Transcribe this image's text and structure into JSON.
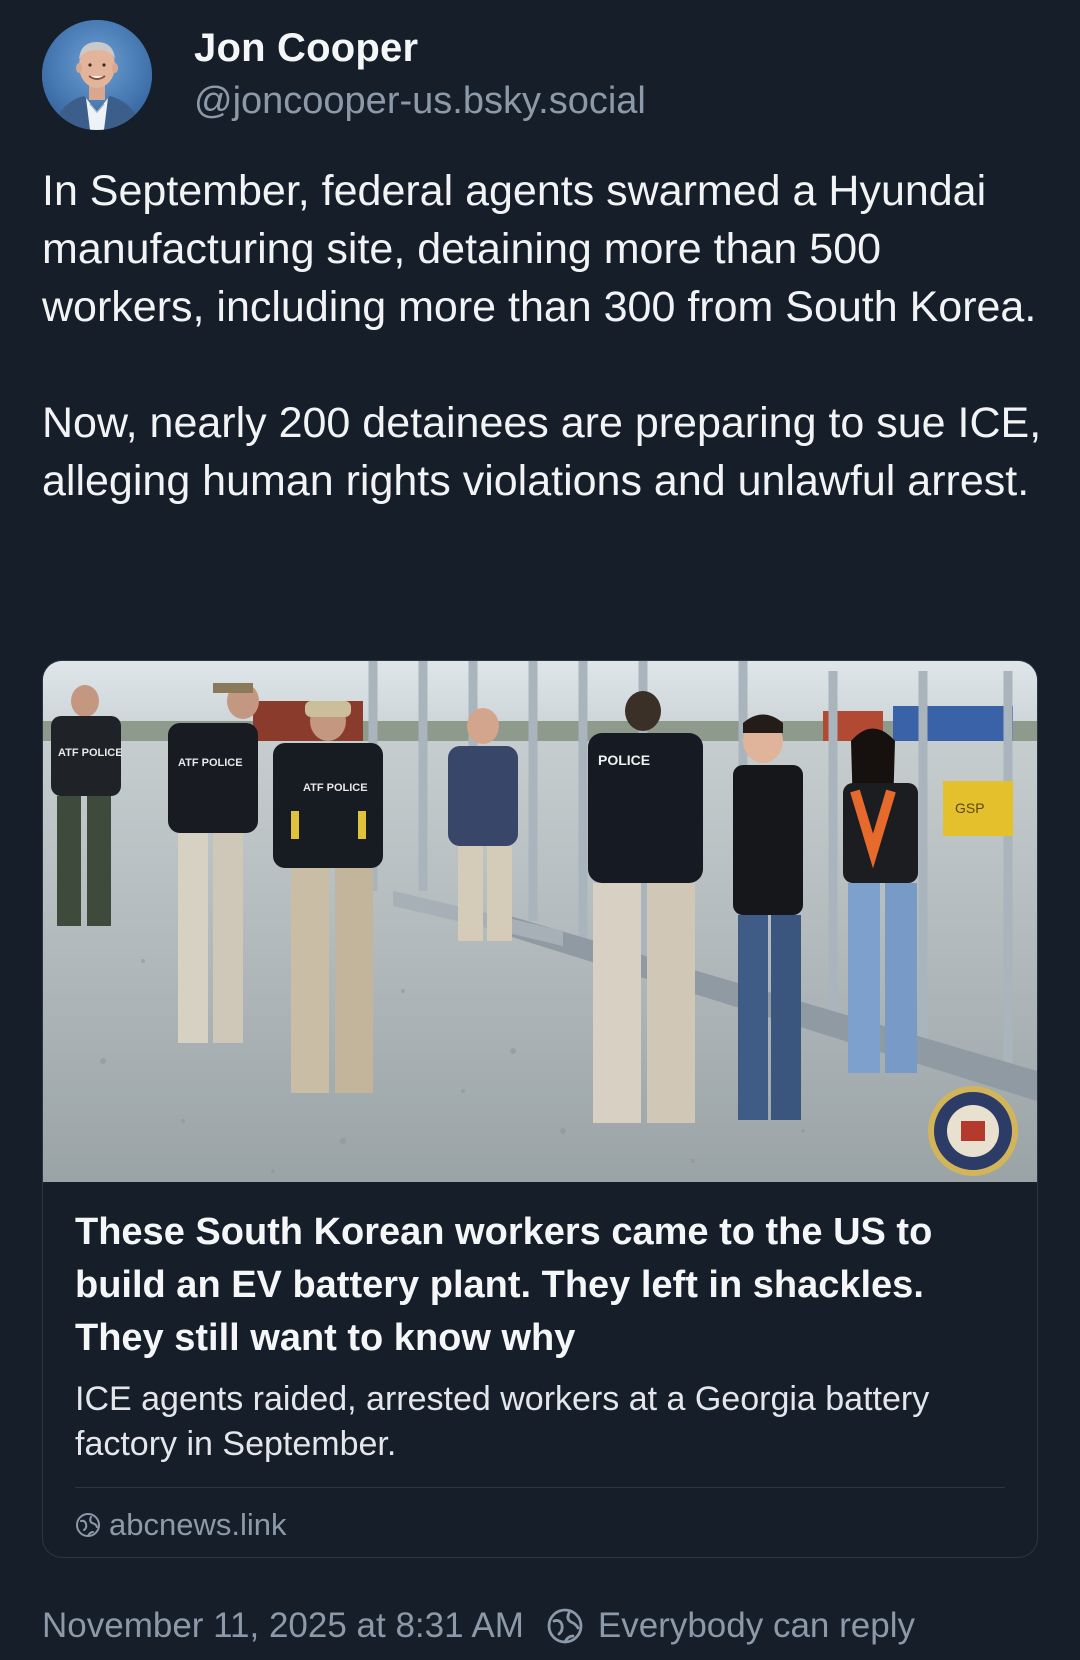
{
  "author": {
    "display_name": "Jon Cooper",
    "handle": "@joncooper-us.bsky.social",
    "avatar_icon": "profile-photo"
  },
  "post": {
    "paragraphs": [
      "In September, federal agents swarmed a Hyundai manufacturing site, detaining more than 500 workers, including more than 300 from South Korea.",
      "Now, nearly 200 detainees are preparing to sue ICE, alleging human rights violations and unlawful arrest."
    ]
  },
  "link_card": {
    "image_icon": "photo-of-agents-detaining-workers",
    "image_text": {
      "vest_labels": [
        "ATF POLICE",
        "ATF POLICE",
        "ATF POLICE",
        "POLICE"
      ],
      "sign": "GSP"
    },
    "title": "These South Korean workers came to the US to build an EV battery plant. They left in shackles. They still want to know why",
    "description": "ICE agents raided, arrested workers at a Georgia battery factory in September.",
    "source_icon": "globe-icon",
    "source": "abcnews.link"
  },
  "footer": {
    "timestamp": "November 11, 2025 at 8:31 AM",
    "reply_icon": "globe-icon",
    "reply_setting": "Everybody can reply"
  },
  "colors": {
    "background": "#161e29",
    "text": "#f1f3f5",
    "muted": "#8c99a8",
    "border": "#2b3644"
  }
}
